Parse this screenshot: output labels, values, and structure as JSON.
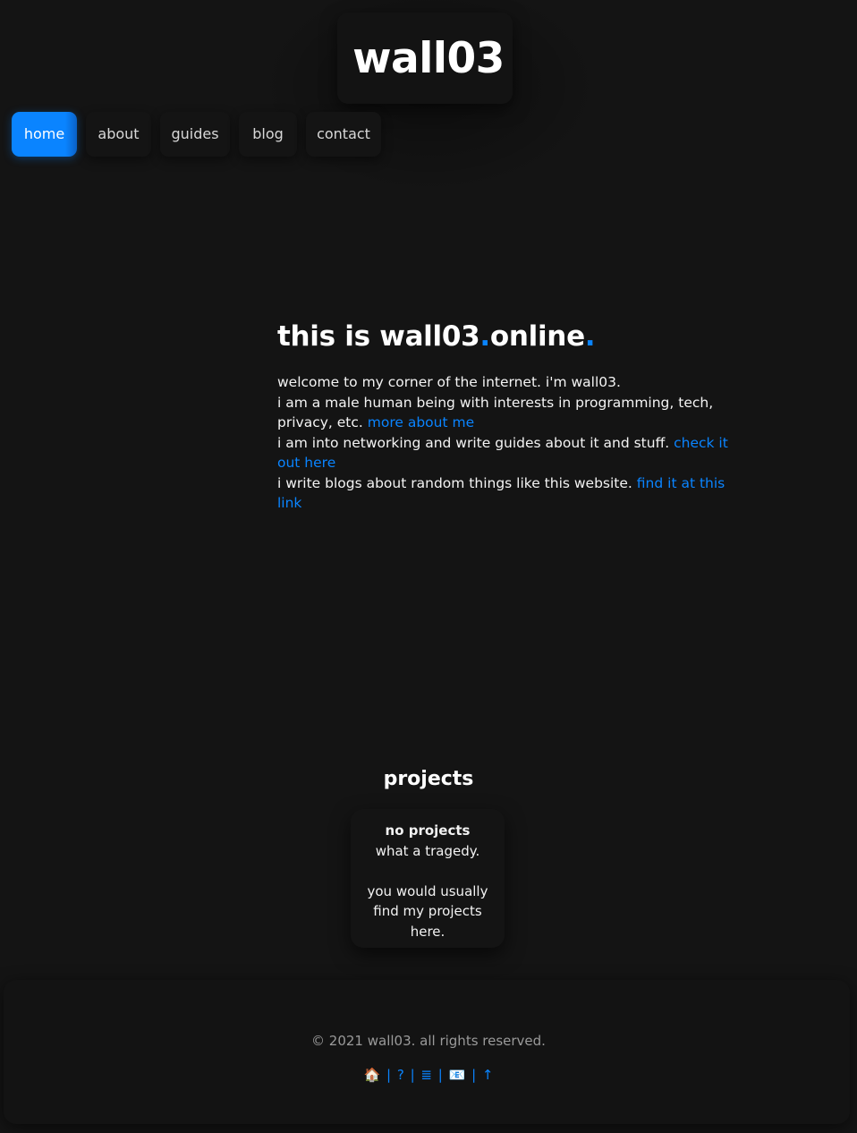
{
  "header": {
    "site_title": "wall03"
  },
  "nav": {
    "items": [
      {
        "label": "home",
        "active": true
      },
      {
        "label": "about",
        "active": false
      },
      {
        "label": "guides",
        "active": false
      },
      {
        "label": "blog",
        "active": false
      },
      {
        "label": "contact",
        "active": false
      }
    ]
  },
  "intro": {
    "title_part1": "this is wall03",
    "title_dot1": ".",
    "title_part2": "online",
    "title_dot2": ".",
    "line1": "welcome to my corner of the internet. i'm wall03.",
    "line2": "i am a male human being with interests in programming, tech, privacy, etc.",
    "line2_link": "more about me",
    "line3": "i am into networking and write guides about it and stuff.",
    "line3_link": "check it out here",
    "line4": "i write blogs about random things like this website.",
    "line4_link": "find it at this link"
  },
  "projects": {
    "title": "projects",
    "card_title": "no projects",
    "card_line1": "what a tragedy.",
    "card_line2": "you would usually find my projects here."
  },
  "footer": {
    "copyright": "© 2021 wall03. all rights reserved.",
    "links": {
      "home": "🏠",
      "about": "?",
      "guides": "≣",
      "contact": "📧",
      "top": "↑",
      "separator": "|"
    }
  },
  "colors": {
    "accent": "#0a84ff",
    "background": "#141414",
    "text": "#ffffff",
    "muted": "#9a9a9a"
  }
}
